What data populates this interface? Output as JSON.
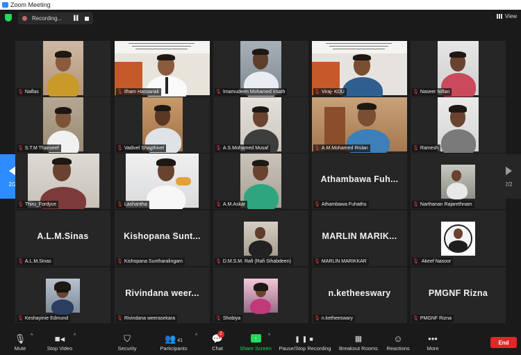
{
  "window": {
    "title": "Zoom Meeting"
  },
  "recording": {
    "label": "Recording..."
  },
  "view": {
    "label": "View"
  },
  "pager": {
    "left_page": "2/2",
    "right_page": "2/2"
  },
  "participants": [
    {
      "name": "Naflas",
      "big": ""
    },
    {
      "name": "Ilham Hassanali",
      "big": ""
    },
    {
      "name": "Imamudeen Mohamed Irsath",
      "big": ""
    },
    {
      "name": "Viraj- KDU",
      "big": ""
    },
    {
      "name": "Naseer Niflan",
      "big": ""
    },
    {
      "name": "S.T.M Thanseef",
      "big": ""
    },
    {
      "name": "Vadivel Shagthivel",
      "big": ""
    },
    {
      "name": "A.S.Mohamed Musaf",
      "big": ""
    },
    {
      "name": "A.M.Mohamed Rislan",
      "big": ""
    },
    {
      "name": "Ramesh",
      "big": ""
    },
    {
      "name": "Thiru_Fordyce",
      "big": ""
    },
    {
      "name": "Lashantha",
      "big": ""
    },
    {
      "name": "A.M.Askar",
      "big": ""
    },
    {
      "name": "Athambawa Fuhathu",
      "big": "Athambawa  Fuh..."
    },
    {
      "name": "Narthanan Rajarethnam",
      "big": ""
    },
    {
      "name": "A.L.M.Sinas",
      "big": "A.L.M.Sinas"
    },
    {
      "name": "Kishopana Suntharalingam",
      "big": "Kishopana  Sunt..."
    },
    {
      "name": "D.M.S.M. Rafi (Rafi Sihabdeen)",
      "big": ""
    },
    {
      "name": "MARLIN MARIKKAR",
      "big": "MARLIN  MARIK..."
    },
    {
      "name": "Akeef Nasoor",
      "big": ""
    },
    {
      "name": "Keshayinie Edmund",
      "big": ""
    },
    {
      "name": "Rivindana weerasekara",
      "big": "Rivindana  weer..."
    },
    {
      "name": "Shobiya",
      "big": ""
    },
    {
      "name": "n.ketheeswary",
      "big": "n.ketheeswary"
    },
    {
      "name": "PMGNF Rizna",
      "big": "PMGNF Rizna"
    }
  ],
  "toolbar": {
    "mute": "Mute",
    "stop_video": "Stop Video",
    "security": "Security",
    "participants": "Participants",
    "participant_count": "41",
    "chat": "Chat",
    "chat_badge": "2",
    "share_screen": "Share Screen",
    "record": "Pause/Stop Recording",
    "breakout": "Breakout Rooms",
    "reactions": "Reactions",
    "more": "More",
    "end": "End"
  },
  "colors": {
    "accent_green": "#23d959",
    "end_red": "#e02828",
    "pager_blue": "#2d8cff",
    "muted_red": "#e03e3e"
  }
}
